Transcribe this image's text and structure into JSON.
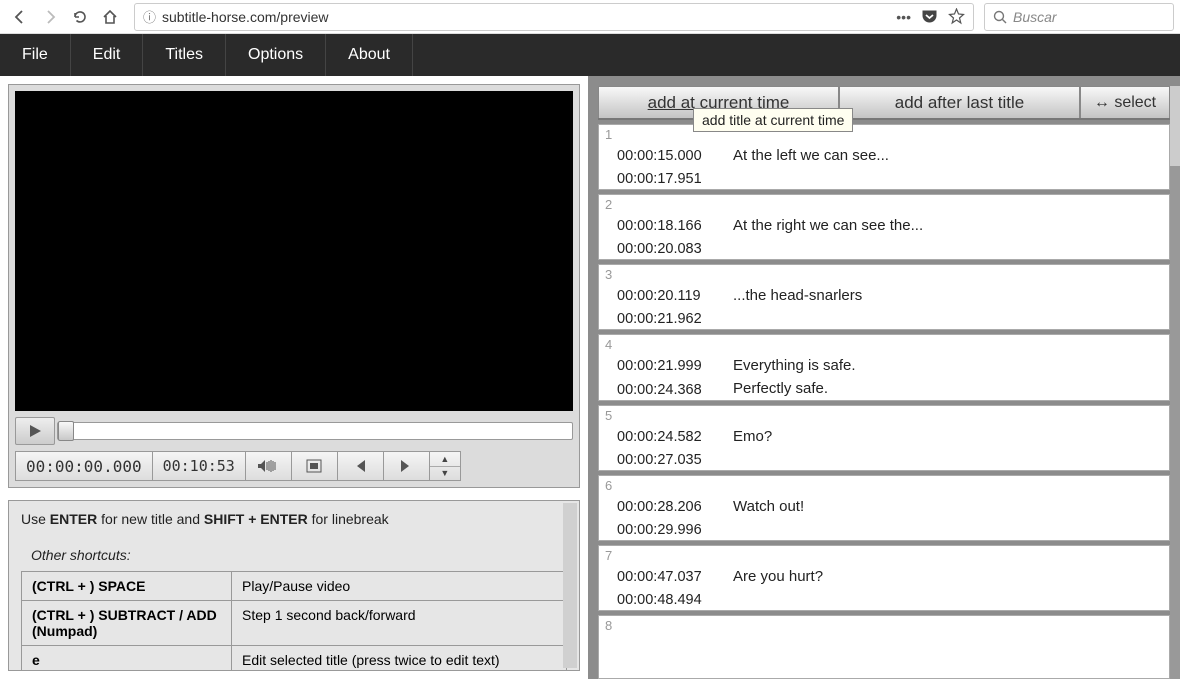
{
  "browser": {
    "url": "subtitle-horse.com/preview",
    "search_placeholder": "Buscar"
  },
  "menu": [
    "File",
    "Edit",
    "Titles",
    "Options",
    "About"
  ],
  "player": {
    "current_time": "00:00:00.000",
    "duration": "00:10:53"
  },
  "help": {
    "intro_prefix": "Use ",
    "intro_enter": "ENTER",
    "intro_mid": " for new title and ",
    "intro_shift": "SHIFT + ENTER",
    "intro_suffix": " for linebreak",
    "subheading": "Other shortcuts:",
    "shortcuts": [
      {
        "key": "(CTRL + ) SPACE",
        "desc": "Play/Pause video"
      },
      {
        "key": "(CTRL + ) SUBTRACT / ADD (Numpad)",
        "desc": "Step 1 second back/forward"
      },
      {
        "key": "e",
        "desc": "Edit selected title (press twice to edit text)"
      }
    ]
  },
  "tabs": {
    "add_current": "add at current time",
    "add_after": "add after last title",
    "select": "↔ select",
    "tooltip": "add title at current time"
  },
  "subtitles": [
    {
      "n": "1",
      "start": "00:00:15.000",
      "end": "00:00:17.951",
      "text": "At the left we can see..."
    },
    {
      "n": "2",
      "start": "00:00:18.166",
      "end": "00:00:20.083",
      "text": "At the right we can see the..."
    },
    {
      "n": "3",
      "start": "00:00:20.119",
      "end": "00:00:21.962",
      "text": "...the head-snarlers"
    },
    {
      "n": "4",
      "start": "00:00:21.999",
      "end": "00:00:24.368",
      "text": "Everything is safe.\nPerfectly safe."
    },
    {
      "n": "5",
      "start": "00:00:24.582",
      "end": "00:00:27.035",
      "text": "Emo?"
    },
    {
      "n": "6",
      "start": "00:00:28.206",
      "end": "00:00:29.996",
      "text": "Watch out!"
    },
    {
      "n": "7",
      "start": "00:00:47.037",
      "end": "00:00:48.494",
      "text": "Are you hurt?"
    },
    {
      "n": "8",
      "start": "",
      "end": "",
      "text": ""
    }
  ]
}
